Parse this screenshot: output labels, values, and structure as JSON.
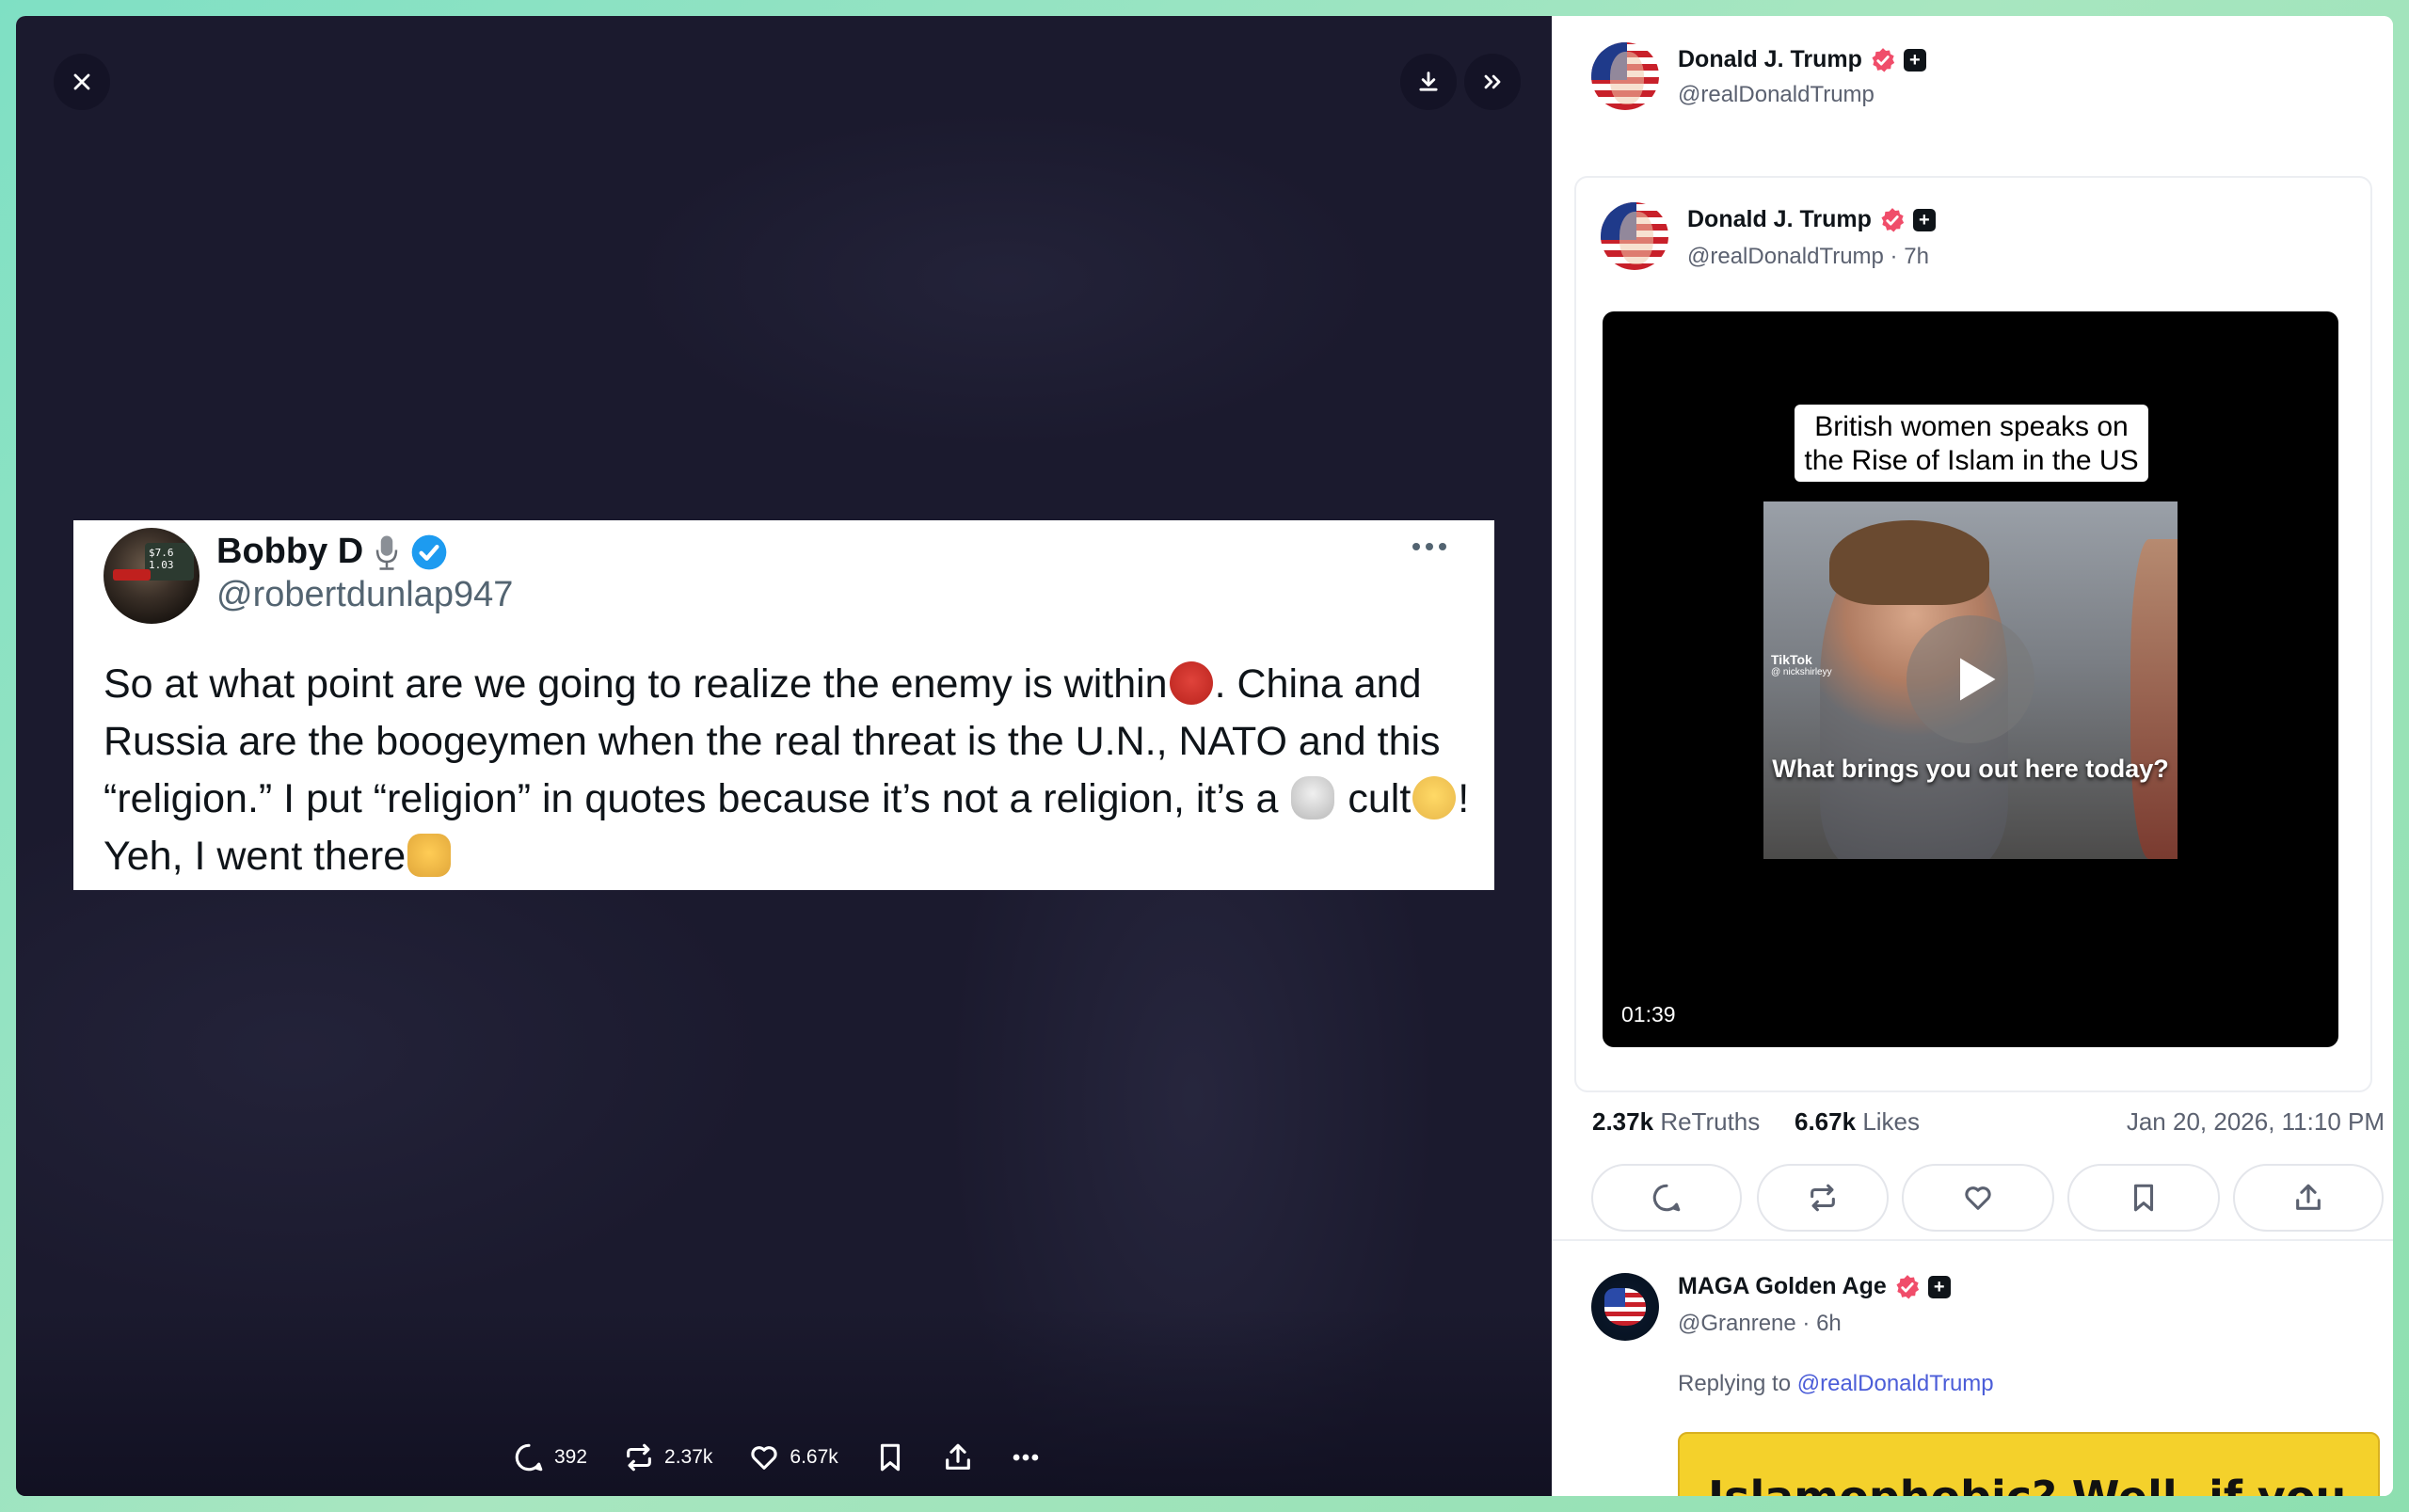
{
  "viewer": {
    "close_icon": "close-icon",
    "download_icon": "download-icon",
    "collapse_icon": "chevrons-right-icon",
    "quote": {
      "name": "Bobby D",
      "handle": "@robertdunlap947",
      "avatar_sign_text": "$7.6 1.03",
      "text_part1": "So at what point are we going to realize the enemy is within",
      "text_part2": ". China and Russia are the boogeymen when the real threat is the U.N., NATO and this “religion.” I put “religion” in quotes because it’s not a religion, it’s a ",
      "text_part3": " cult",
      "text_part4": "! Yeh, I went there"
    },
    "actions": {
      "replies": "392",
      "retruths": "2.37k",
      "likes": "6.67k"
    }
  },
  "panel": {
    "header_author": {
      "name": "Donald J. Trump",
      "handle": "@realDonaldTrump"
    },
    "post": {
      "name": "Donald J. Trump",
      "handle_time": "@realDonaldTrump · 7h",
      "video": {
        "caption": "British women speaks on the Rise of Islam in the US",
        "subtitle": "What brings you out here today?",
        "watermark": "TikTok",
        "watermark_handle": "@ nickshirleyy",
        "duration": "01:39"
      }
    },
    "stats": {
      "retruths_count": "2.37k",
      "retruths_label": "ReTruths",
      "likes_count": "6.67k",
      "likes_label": "Likes",
      "date": "Jan 20, 2026, 11:10 PM"
    },
    "reply": {
      "name": "MAGA Golden Age",
      "handle_time": "@Granrene · 6h",
      "replying_prefix": "Replying to ",
      "replying_handle": "@realDonaldTrump",
      "media_text": "Islamophobic? Well, if you"
    }
  },
  "colors": {
    "viewer_bg": "#1b1a2e",
    "verified_badge": "#f04d6a",
    "link": "#4b5dd8",
    "frame_gradient": "#7fe0c4"
  }
}
